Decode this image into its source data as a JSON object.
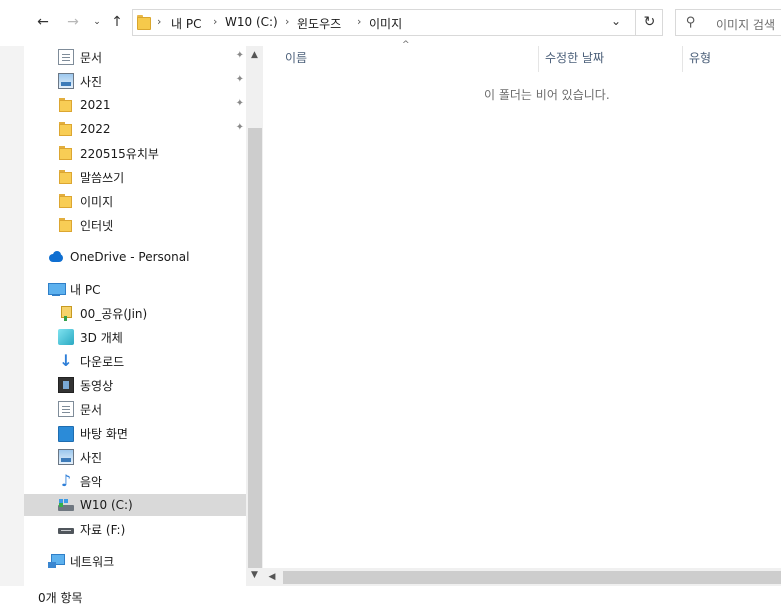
{
  "address": {
    "crumbs": [
      "내 PC",
      "W10 (C:)",
      "윈도우즈",
      "이미지"
    ],
    "separators": [
      "›",
      "›",
      "›",
      "›"
    ]
  },
  "search": {
    "placeholder": "이미지 검색"
  },
  "nav": {
    "quick_access": [
      {
        "label": "문서",
        "icon": "document-icon",
        "pinned": true
      },
      {
        "label": "사진",
        "icon": "pictures-icon",
        "pinned": true
      },
      {
        "label": "2021",
        "icon": "folder-icon",
        "pinned": true
      },
      {
        "label": "2022",
        "icon": "folder-icon",
        "pinned": true
      },
      {
        "label": "220515유치부",
        "icon": "folder-icon",
        "pinned": false
      },
      {
        "label": "말씀쓰기",
        "icon": "folder-icon",
        "pinned": false
      },
      {
        "label": "이미지",
        "icon": "folder-icon",
        "pinned": false
      },
      {
        "label": "인터넷",
        "icon": "folder-icon",
        "pinned": false
      }
    ],
    "onedrive": "OneDrive - Personal",
    "this_pc": "내 PC",
    "pc_items": [
      {
        "label": "00_공유(Jin)",
        "icon": "shared-folder-icon"
      },
      {
        "label": "3D 개체",
        "icon": "3d-objects-icon"
      },
      {
        "label": "다운로드",
        "icon": "download-icon"
      },
      {
        "label": "동영상",
        "icon": "video-icon"
      },
      {
        "label": "문서",
        "icon": "document-icon"
      },
      {
        "label": "바탕 화면",
        "icon": "desktop-icon"
      },
      {
        "label": "사진",
        "icon": "pictures-icon"
      },
      {
        "label": "음악",
        "icon": "music-icon"
      },
      {
        "label": "W10 (C:)",
        "icon": "drive-icon",
        "selected": true
      },
      {
        "label": "자료 (F:)",
        "icon": "usb-drive-icon"
      }
    ],
    "network": "네트워크"
  },
  "columns": {
    "name": "이름",
    "modified": "수정한 날짜",
    "type": "유형"
  },
  "empty_message": "이 폴더는 비어 있습니다.",
  "status": {
    "count": "0개 항목"
  },
  "colors": {
    "selected_bg": "#d9d9d9",
    "folder": "#f8cd55",
    "column_header": "#4c607a"
  }
}
